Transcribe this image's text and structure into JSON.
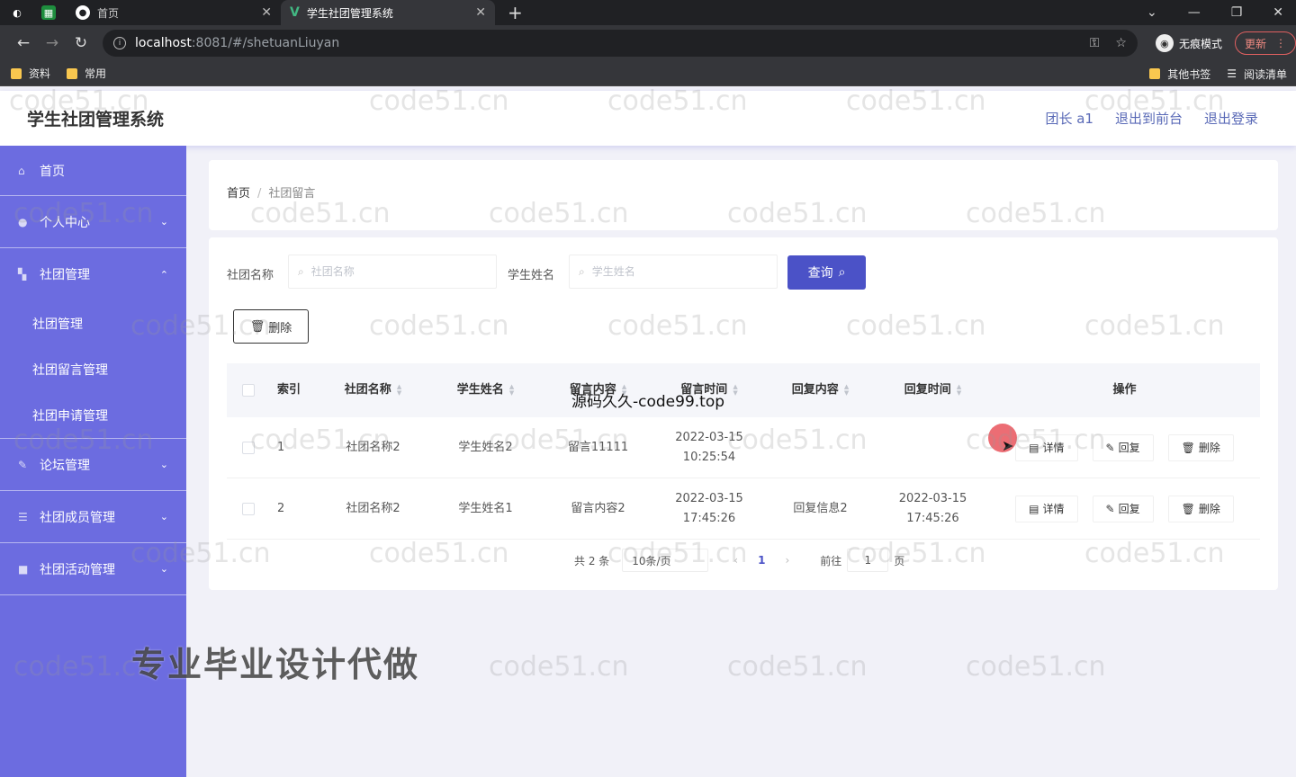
{
  "browser": {
    "tabs": [
      {
        "title": "首页"
      },
      {
        "title": "学生社团管理系统"
      }
    ],
    "url_host": "localhost",
    "url_path": ":8081/#/shetuanLiuyan",
    "incognito_label": "无痕模式",
    "update_label": "更新",
    "bookmarks": [
      "资料",
      "常用"
    ],
    "bookmarks_right": [
      "其他书签",
      "阅读清单"
    ]
  },
  "header": {
    "title": "学生社团管理系统",
    "links": [
      "团长 a1",
      "退出到前台",
      "退出登录"
    ]
  },
  "sidebar": {
    "home": "首页",
    "personal": "个人中心",
    "club_mgmt": "社团管理",
    "sub_items": [
      "社团管理",
      "社团留言管理",
      "社团申请管理"
    ],
    "forum": "论坛管理",
    "members": "社团成员管理",
    "activities": "社团活动管理"
  },
  "breadcrumb": {
    "home": "首页",
    "sep": "/",
    "current": "社团留言"
  },
  "filters": {
    "club_label": "社团名称",
    "club_placeholder": "社团名称",
    "student_label": "学生姓名",
    "student_placeholder": "学生姓名",
    "query_label": "查询",
    "delete_label": "删除"
  },
  "table": {
    "headers": {
      "index": "索引",
      "club": "社团名称",
      "student": "学生姓名",
      "message": "留言内容",
      "time": "留言时间",
      "reply": "回复内容",
      "reply_time": "回复时间",
      "ops": "操作"
    },
    "rows": [
      {
        "index": "1",
        "club": "社团名称2",
        "student": "学生姓名2",
        "message": "留言11111",
        "time": "2022-03-15 10:25:54",
        "reply": "",
        "reply_time": ""
      },
      {
        "index": "2",
        "club": "社团名称2",
        "student": "学生姓名1",
        "message": "留言内容2",
        "time": "2022-03-15 17:45:26",
        "reply": "回复信息2",
        "reply_time": "2022-03-15 17:45:26"
      }
    ],
    "ops": {
      "detail": "详情",
      "reply": "回复",
      "delete": "删除"
    }
  },
  "pagination": {
    "total": "共 2 条",
    "page_size": "10条/页",
    "current_page": "1",
    "goto_label": "前往",
    "goto_value": "1",
    "page_unit": "页"
  },
  "watermarks": {
    "repeat": "code51.cn",
    "site": "源码久久-code99.top",
    "promo": "专业毕业设计代做"
  }
}
